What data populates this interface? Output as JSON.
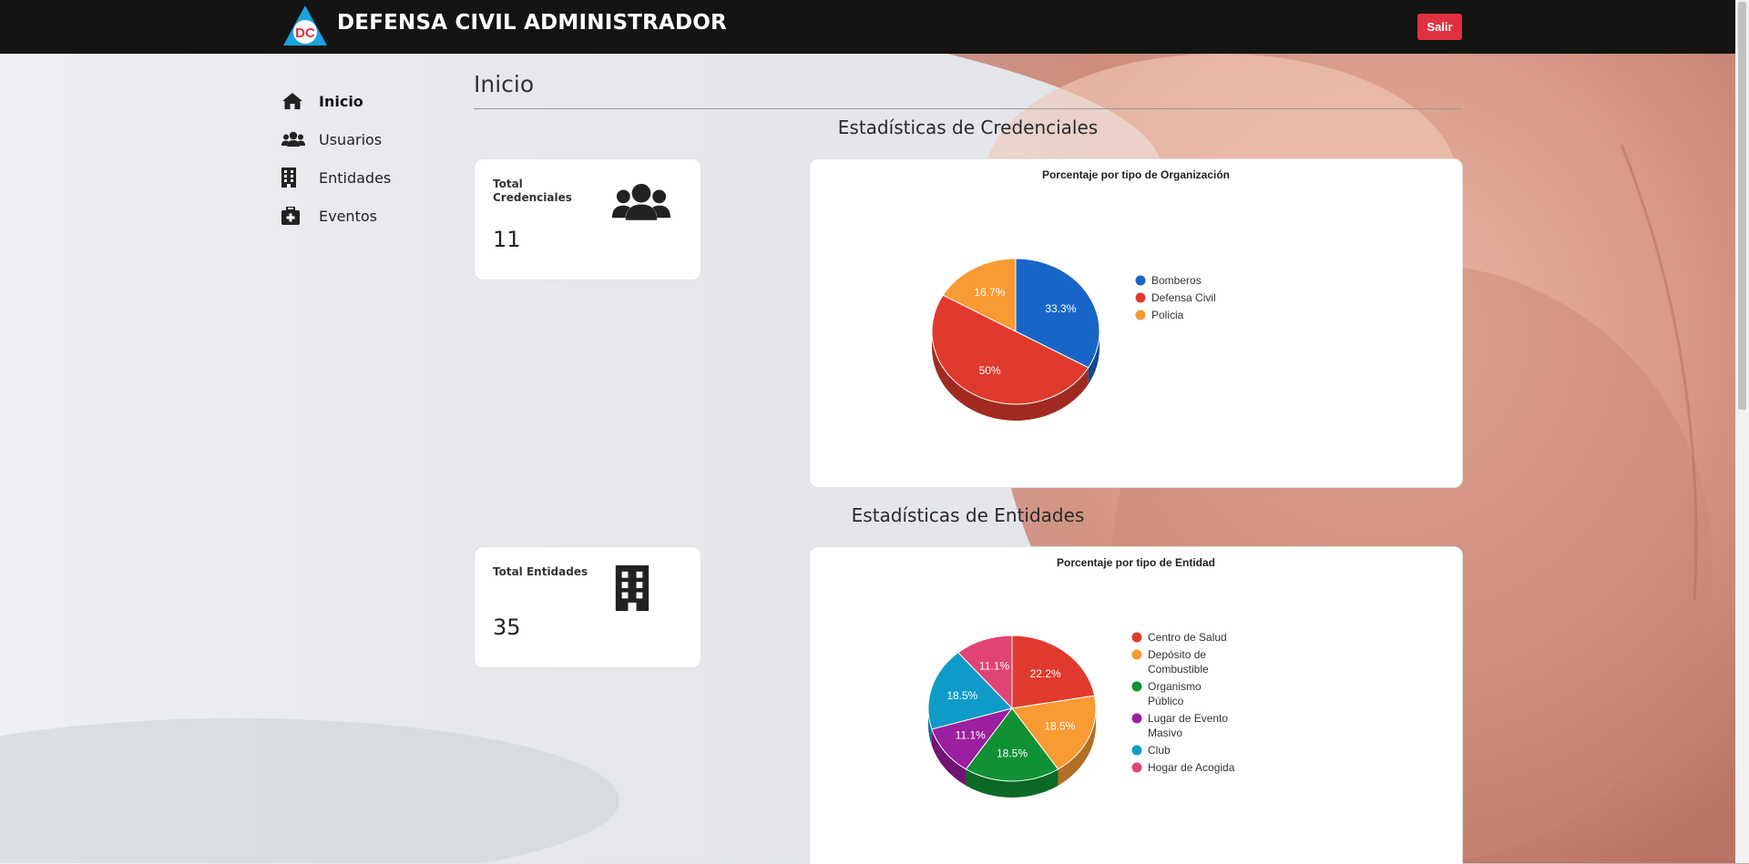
{
  "header": {
    "title": "DEFENSA CIVIL ADMINISTRADOR",
    "logo_text": "DC",
    "logout_label": "Salir"
  },
  "sidebar": {
    "items": [
      {
        "label": "Inicio",
        "icon": "home-icon",
        "active": true
      },
      {
        "label": "Usuarios",
        "icon": "users-icon",
        "active": false
      },
      {
        "label": "Entidades",
        "icon": "building-icon",
        "active": false
      },
      {
        "label": "Eventos",
        "icon": "first-aid-kit-icon",
        "active": false
      }
    ]
  },
  "main": {
    "page_title": "Inicio",
    "credentials": {
      "section_title": "Estadísticas de Credenciales",
      "card_label": "Total Credenciales",
      "card_value": "11",
      "card_icon": "users-icon"
    },
    "entities": {
      "section_title": "Estadísticas de Entidades",
      "card_label": "Total Entidades",
      "card_value": "35",
      "card_icon": "building-icon"
    }
  },
  "chart_data": [
    {
      "type": "pie",
      "title": "Porcentaje por tipo de Organización",
      "legend_position": "right",
      "slices": [
        {
          "label": "Bomberos",
          "value": 33.3,
          "display": "33.3%",
          "color": "#1766c7"
        },
        {
          "label": "Defensa Civil",
          "value": 50,
          "display": "50%",
          "color": "#e03a2c"
        },
        {
          "label": "Policia",
          "value": 16.7,
          "display": "16.7%",
          "color": "#f99a33"
        }
      ]
    },
    {
      "type": "pie",
      "title": "Porcentaje por tipo de Entidad",
      "legend_position": "right",
      "slices": [
        {
          "label": "Centro de Salud",
          "value": 22.2,
          "display": "22.2%",
          "color": "#e03a2c"
        },
        {
          "label": "Depósito de Combustible",
          "value": 18.5,
          "display": "18.5%",
          "color": "#f99a33"
        },
        {
          "label": "Organismo Público",
          "value": 18.5,
          "display": "18.5%",
          "color": "#0f9134"
        },
        {
          "label": "Lugar de Evento Masivo",
          "value": 11.1,
          "display": "11.1%",
          "color": "#9c1f9f"
        },
        {
          "label": "Club",
          "value": 18.5,
          "display": "18.5%",
          "color": "#0f9bc7"
        },
        {
          "label": "Hogar de Acogida",
          "value": 11.1,
          "display": "11.1%",
          "color": "#e24476"
        }
      ]
    }
  ]
}
